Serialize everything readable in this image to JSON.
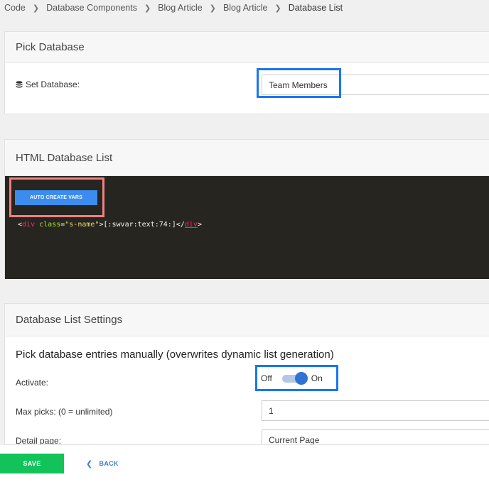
{
  "breadcrumb": {
    "items": [
      "Code",
      "Database Components",
      "Blog Article",
      "Blog Article"
    ],
    "current": "Database List",
    "separator": ">"
  },
  "pick_database": {
    "title": "Pick Database",
    "set_label": "Set Database:",
    "database_value": "Team Members"
  },
  "html_list": {
    "title": "HTML Database List",
    "auto_button": "AUTO CREATE VARS",
    "code": {
      "open_bracket": "<",
      "tag": "div",
      "attr": "class",
      "equals": "=",
      "value": "\"s-name\"",
      "close_open": ">",
      "content": "[:swvar:text:74:]",
      "end_open": "</",
      "end_tag": "div",
      "end_close": ">"
    }
  },
  "settings": {
    "title": "Database List Settings",
    "subheading": "Pick database entries manually (overwrites dynamic list generation)",
    "activate_label": "Activate:",
    "toggle_off": "Off",
    "toggle_on": "On",
    "toggle_state": "on",
    "max_picks_label": "Max picks: (0 = unlimited)",
    "max_picks_value": "1",
    "detail_page_label": "Detail page:",
    "detail_page_value": "Current Page"
  },
  "footer": {
    "save_label": "SAVE",
    "back_label": "BACK"
  },
  "colors": {
    "highlight_blue": "#1976f2",
    "highlight_red": "#f08080",
    "primary_button": "#3c8cf0",
    "save_green": "#12c35a",
    "code_bg": "#26251f"
  }
}
